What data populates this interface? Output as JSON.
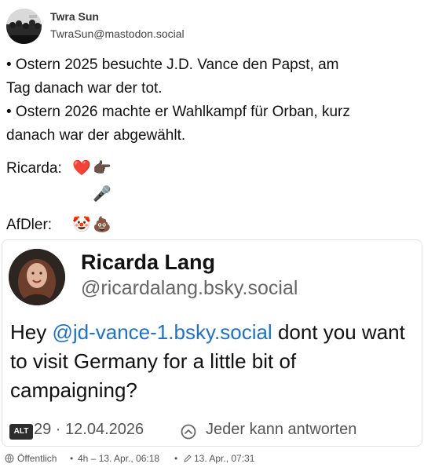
{
  "author": {
    "name": "Twra Sun",
    "handle": "TwraSun@mastodon.social",
    "avatar_icon": "grayscale-crowd-avatar"
  },
  "post": {
    "lines": [
      "• Ostern 2025 besuchte J.D. Vance den Papst, am",
      "Tag danach war der tot.",
      "• Ostern 2026 machte er Wahlkampf für Orban, kurz",
      "danach war der abgewählt."
    ],
    "reactions": [
      {
        "label": "Ricarda:",
        "emojis": [
          "❤️",
          "👉🏿",
          "🎤"
        ],
        "emoji_names": [
          "red-heart-icon",
          "pointing-hand-icon",
          "microphone-icon"
        ]
      },
      {
        "label": "AfDler:",
        "emojis": [
          "🤡",
          "💩"
        ],
        "emoji_names": [
          "clown-face-icon",
          "pile-of-poo-icon"
        ]
      }
    ]
  },
  "embedded_post": {
    "name": "Ricarda Lang",
    "handle": "@ricardalang.bsky.social",
    "text_before": "Hey ",
    "mention": "@jd-vance-1.bsky.social",
    "text_after": "  dont you want to visit Germany for a little bit of campaigning?",
    "alt_badge": "ALT",
    "footer_count_date": "29 · 12.04.2026",
    "reply_setting": "Jeder kann antworten"
  },
  "meta": {
    "visibility": "Öffentlich",
    "sep": "•",
    "time": "4h – 13. Apr., 06:18",
    "edited": "13. Apr., 07:31"
  },
  "colors": {
    "mention": "#1f72c7",
    "text": "#111111",
    "muted": "#555555",
    "border": "#e2e2e2"
  }
}
